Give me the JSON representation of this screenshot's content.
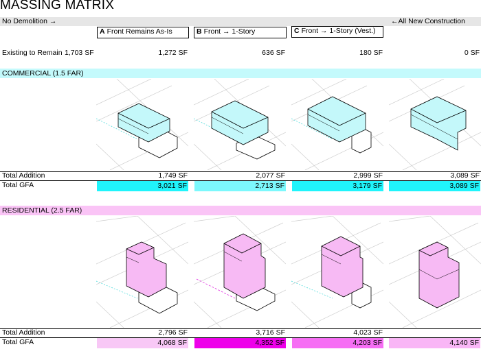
{
  "title": "MASSING MATRIX",
  "scale": {
    "left_label": "No Demolition →",
    "right_label": "←All New Construction"
  },
  "columns": [
    {
      "letter": "A",
      "label": "Front Remains As-Is"
    },
    {
      "letter": "B",
      "label": "Front → 1-Story"
    },
    {
      "letter": "C",
      "label": "Front → 1-Story (Vest.)"
    }
  ],
  "existing": {
    "label": "Existing to Remain",
    "baseline": "1,703 SF",
    "values": [
      "1,272 SF",
      "636 SF",
      "180 SF",
      "0 SF"
    ]
  },
  "commercial": {
    "label": "COMMERCIAL (1.5 FAR)",
    "total_addition_label": "Total Addition",
    "total_addition": [
      "1,749 SF",
      "2,077 SF",
      "2,999 SF",
      "3,089 SF"
    ],
    "total_gfa_label": "Total GFA",
    "total_gfa": [
      "3,021 SF",
      "2,713 SF",
      "3,179 SF",
      "3,089 SF"
    ],
    "gfa_colors": [
      "#20f4fb",
      "#7cf8fc",
      "#20f4fb",
      "#20f4fb"
    ],
    "mass_color": "#c4f8fa"
  },
  "residential": {
    "label": "RESIDENTIAL (2.5 FAR)",
    "total_addition_label": "Total Addition",
    "total_addition": [
      "2,796 SF",
      "3,716 SF",
      "4,023 SF",
      ""
    ],
    "total_gfa_label": "Total GFA",
    "total_gfa": [
      "4,068 SF",
      "4,352 SF",
      "4,203 SF",
      "4,140 SF"
    ],
    "gfa_colors": [
      "#f8c8f6",
      "#ee00ea",
      "#f66ef4",
      "#f9b6f6"
    ],
    "mass_color": "#f7baf4"
  }
}
